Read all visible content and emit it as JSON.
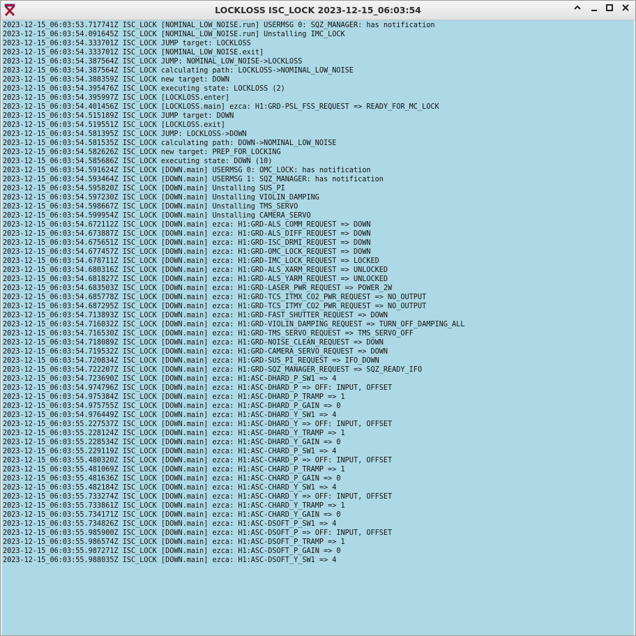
{
  "window": {
    "title": "LOCKLOSS ISC_LOCK 2023-12-15_06:03:54",
    "app_icon": "guardian-red-x-icon",
    "buttons": [
      "chevron-up-icon",
      "minimize-icon",
      "maximize-icon",
      "close-icon"
    ]
  },
  "log": {
    "background_color": "#add8e6",
    "lines": [
      "2023-12-15_06:03:53.717741Z ISC_LOCK [NOMINAL_LOW_NOISE.run] USERMSG 0: SQZ_MANAGER: has notification",
      "2023-12-15_06:03:54.091645Z ISC_LOCK [NOMINAL_LOW_NOISE.run] Unstalling IMC_LOCK",
      "2023-12-15_06:03:54.333701Z ISC_LOCK JUMP target: LOCKLOSS",
      "2023-12-15_06:03:54.333701Z ISC_LOCK [NOMINAL_LOW_NOISE.exit]",
      "2023-12-15_06:03:54.387564Z ISC_LOCK JUMP: NOMINAL_LOW_NOISE->LOCKLOSS",
      "2023-12-15_06:03:54.387564Z ISC_LOCK calculating path: LOCKLOSS->NOMINAL_LOW_NOISE",
      "2023-12-15_06:03:54.388359Z ISC_LOCK new target: DOWN",
      "2023-12-15_06:03:54.395476Z ISC_LOCK executing state: LOCKLOSS (2)",
      "2023-12-15_06:03:54.395997Z ISC_LOCK [LOCKLOSS.enter]",
      "2023-12-15_06:03:54.401456Z ISC_LOCK [LOCKLOSS.main] ezca: H1:GRD-PSL_FSS_REQUEST => READY_FOR_MC_LOCK",
      "2023-12-15_06:03:54.515189Z ISC_LOCK JUMP target: DOWN",
      "2023-12-15_06:03:54.519551Z ISC_LOCK [LOCKLOSS.exit]",
      "2023-12-15_06:03:54.581395Z ISC_LOCK JUMP: LOCKLOSS->DOWN",
      "2023-12-15_06:03:54.581535Z ISC_LOCK calculating path: DOWN->NOMINAL_LOW_NOISE",
      "2023-12-15_06:03:54.582626Z ISC_LOCK new target: PREP_FOR_LOCKING",
      "2023-12-15_06:03:54.585686Z ISC_LOCK executing state: DOWN (10)",
      "2023-12-15_06:03:54.591624Z ISC_LOCK [DOWN.main] USERMSG 0: OMC_LOCK: has notification",
      "2023-12-15_06:03:54.593464Z ISC_LOCK [DOWN.main] USERMSG 1: SQZ_MANAGER: has notification",
      "2023-12-15_06:03:54.595820Z ISC_LOCK [DOWN.main] Unstalling SUS_PI",
      "2023-12-15_06:03:54.597230Z ISC_LOCK [DOWN.main] Unstalling VIOLIN_DAMPING",
      "2023-12-15_06:03:54.598667Z ISC_LOCK [DOWN.main] Unstalling TMS_SERVO",
      "2023-12-15_06:03:54.599954Z ISC_LOCK [DOWN.main] Unstalling CAMERA_SERVO",
      "2023-12-15_06:03:54.672112Z ISC_LOCK [DOWN.main] ezca: H1:GRD-ALS_COMM_REQUEST => DOWN",
      "2023-12-15_06:03:54.673887Z ISC_LOCK [DOWN.main] ezca: H1:GRD-ALS_DIFF_REQUEST => DOWN",
      "2023-12-15_06:03:54.675651Z ISC_LOCK [DOWN.main] ezca: H1:GRD-ISC_DRMI_REQUEST => DOWN",
      "2023-12-15_06:03:54.677457Z ISC_LOCK [DOWN.main] ezca: H1:GRD-OMC_LOCK_REQUEST => DOWN",
      "2023-12-15_06:03:54.678711Z ISC_LOCK [DOWN.main] ezca: H1:GRD-IMC_LOCK_REQUEST => LOCKED",
      "2023-12-15_06:03:54.680316Z ISC_LOCK [DOWN.main] ezca: H1:GRD-ALS_XARM_REQUEST => UNLOCKED",
      "2023-12-15_06:03:54.681827Z ISC_LOCK [DOWN.main] ezca: H1:GRD-ALS_YARM_REQUEST => UNLOCKED",
      "2023-12-15_06:03:54.683503Z ISC_LOCK [DOWN.main] ezca: H1:GRD-LASER_PWR_REQUEST => POWER_2W",
      "2023-12-15_06:03:54.685778Z ISC_LOCK [DOWN.main] ezca: H1:GRD-TCS_ITMX_CO2_PWR_REQUEST => NO_OUTPUT",
      "2023-12-15_06:03:54.687295Z ISC_LOCK [DOWN.main] ezca: H1:GRD-TCS_ITMY_CO2_PWR_REQUEST => NO_OUTPUT",
      "2023-12-15_06:03:54.713893Z ISC_LOCK [DOWN.main] ezca: H1:GRD-FAST_SHUTTER_REQUEST => DOWN",
      "2023-12-15_06:03:54.716032Z ISC_LOCK [DOWN.main] ezca: H1:GRD-VIOLIN_DAMPING_REQUEST => TURN_OFF_DAMPING_ALL",
      "2023-12-15_06:03:54.716530Z ISC_LOCK [DOWN.main] ezca: H1:GRD-TMS_SERVO_REQUEST => TMS_SERVO_OFF",
      "2023-12-15_06:03:54.718089Z ISC_LOCK [DOWN.main] ezca: H1:GRD-NOISE_CLEAN_REQUEST => DOWN",
      "2023-12-15_06:03:54.719532Z ISC_LOCK [DOWN.main] ezca: H1:GRD-CAMERA_SERVO_REQUEST => DOWN",
      "2023-12-15_06:03:54.720834Z ISC_LOCK [DOWN.main] ezca: H1:GRD-SUS_PI_REQUEST => IFO_DOWN",
      "2023-12-15_06:03:54.722207Z ISC_LOCK [DOWN.main] ezca: H1:GRD-SQZ_MANAGER_REQUEST => SQZ_READY_IFO",
      "2023-12-15_06:03:54.723690Z ISC_LOCK [DOWN.main] ezca: H1:ASC-DHARD_P_SW1 => 4",
      "2023-12-15_06:03:54.974796Z ISC_LOCK [DOWN.main] ezca: H1:ASC-DHARD_P => OFF: INPUT, OFFSET",
      "2023-12-15_06:03:54.975384Z ISC_LOCK [DOWN.main] ezca: H1:ASC-DHARD_P_TRAMP => 1",
      "2023-12-15_06:03:54.975755Z ISC_LOCK [DOWN.main] ezca: H1:ASC-DHARD_P_GAIN => 0",
      "2023-12-15_06:03:54.976449Z ISC_LOCK [DOWN.main] ezca: H1:ASC-DHARD_Y_SW1 => 4",
      "2023-12-15_06:03:55.227537Z ISC_LOCK [DOWN.main] ezca: H1:ASC-DHARD_Y => OFF: INPUT, OFFSET",
      "2023-12-15_06:03:55.228124Z ISC_LOCK [DOWN.main] ezca: H1:ASC-DHARD_Y_TRAMP => 1",
      "2023-12-15_06:03:55.228534Z ISC_LOCK [DOWN.main] ezca: H1:ASC-DHARD_Y_GAIN => 0",
      "2023-12-15_06:03:55.229119Z ISC_LOCK [DOWN.main] ezca: H1:ASC-CHARD_P_SW1 => 4",
      "2023-12-15_06:03:55.480320Z ISC_LOCK [DOWN.main] ezca: H1:ASC-CHARD_P => OFF: INPUT, OFFSET",
      "2023-12-15_06:03:55.481069Z ISC_LOCK [DOWN.main] ezca: H1:ASC-CHARD_P_TRAMP => 1",
      "2023-12-15_06:03:55.481636Z ISC_LOCK [DOWN.main] ezca: H1:ASC-CHARD_P_GAIN => 0",
      "2023-12-15_06:03:55.482184Z ISC_LOCK [DOWN.main] ezca: H1:ASC-CHARD_Y_SW1 => 4",
      "2023-12-15_06:03:55.733274Z ISC_LOCK [DOWN.main] ezca: H1:ASC-CHARD_Y => OFF: INPUT, OFFSET",
      "2023-12-15_06:03:55.733861Z ISC_LOCK [DOWN.main] ezca: H1:ASC-CHARD_Y_TRAMP => 1",
      "2023-12-15_06:03:55.734171Z ISC_LOCK [DOWN.main] ezca: H1:ASC-CHARD_Y_GAIN => 0",
      "2023-12-15_06:03:55.734826Z ISC_LOCK [DOWN.main] ezca: H1:ASC-DSOFT_P_SW1 => 4",
      "2023-12-15_06:03:55.985900Z ISC_LOCK [DOWN.main] ezca: H1:ASC-DSOFT_P => OFF: INPUT, OFFSET",
      "2023-12-15_06:03:55.986574Z ISC_LOCK [DOWN.main] ezca: H1:ASC-DSOFT_P_TRAMP => 1",
      "2023-12-15_06:03:55.987271Z ISC_LOCK [DOWN.main] ezca: H1:ASC-DSOFT_P_GAIN => 0",
      "2023-12-15_06:03:55.988035Z ISC_LOCK [DOWN.main] ezca: H1:ASC-DSOFT_Y_SW1 => 4"
    ]
  }
}
